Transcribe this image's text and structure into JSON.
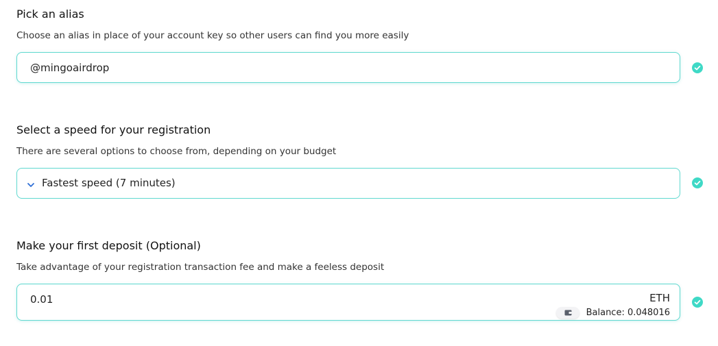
{
  "alias_section": {
    "title": "Pick an alias",
    "description": "Choose an alias in place of your account key so other users can find you more easily",
    "input_value": "@mingoairdrop",
    "status_icon": "check-circle-icon"
  },
  "speed_section": {
    "title": "Select a speed for your registration",
    "description": "There are several options to choose from, depending on your budget",
    "selected_option": "Fastest speed (7 minutes)",
    "dropdown_icon": "chevron-down-icon",
    "status_icon": "check-circle-icon"
  },
  "deposit_section": {
    "title": "Make your first deposit (Optional)",
    "description": "Take advantage of your registration transaction fee and make a feeless deposit",
    "amount_value": "0.01",
    "currency": "ETH",
    "balance_label": "Balance: 0.048016",
    "wallet_icon": "wallet-icon",
    "status_icon": "check-circle-icon"
  },
  "colors": {
    "accent": "#3fd9c6",
    "field_border": "#5fd8cf",
    "chevron": "#2f6fd6"
  }
}
